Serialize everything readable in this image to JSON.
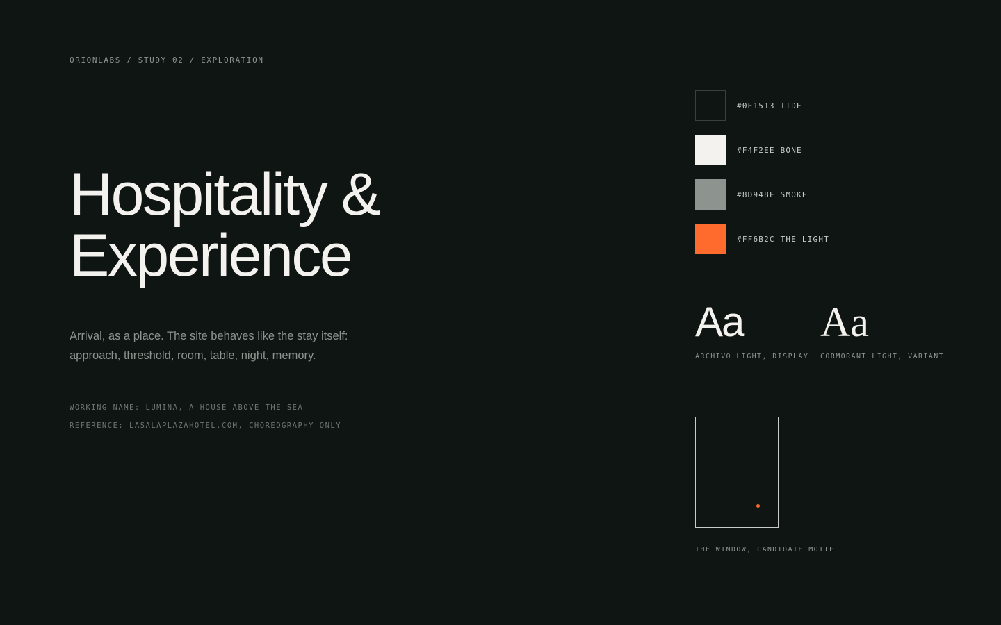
{
  "breadcrumb": "ORIONLABS / STUDY 02 / EXPLORATION",
  "hero": {
    "title_line1": "Hospitality &",
    "title_line2": "Experience",
    "lede": "Arrival, as a place. The site behaves like the stay itself: approach, threshold, room, table, night, memory."
  },
  "notes": {
    "working_name": "WORKING NAME: LUMINA, A HOUSE ABOVE THE SEA",
    "reference": "REFERENCE: LASALAPLAZAHOTEL.COM, CHOREOGRAPHY ONLY"
  },
  "palette": [
    {
      "hex": "#0E1513",
      "label": "#0E1513 TIDE"
    },
    {
      "hex": "#F4F2EE",
      "label": "#F4F2EE BONE"
    },
    {
      "hex": "#8D948F",
      "label": "#8D948F SMOKE"
    },
    {
      "hex": "#FF6B2C",
      "label": "#FF6B2C THE LIGHT"
    }
  ],
  "type": {
    "display": {
      "sample": "Aa",
      "caption": "ARCHIVO LIGHT, DISPLAY"
    },
    "variant": {
      "sample": "Aa",
      "caption": "CORMORANT LIGHT, VARIANT"
    }
  },
  "motif": {
    "caption": "THE WINDOW, CANDIDATE MOTIF",
    "dot_color": "#FF6B2C"
  }
}
